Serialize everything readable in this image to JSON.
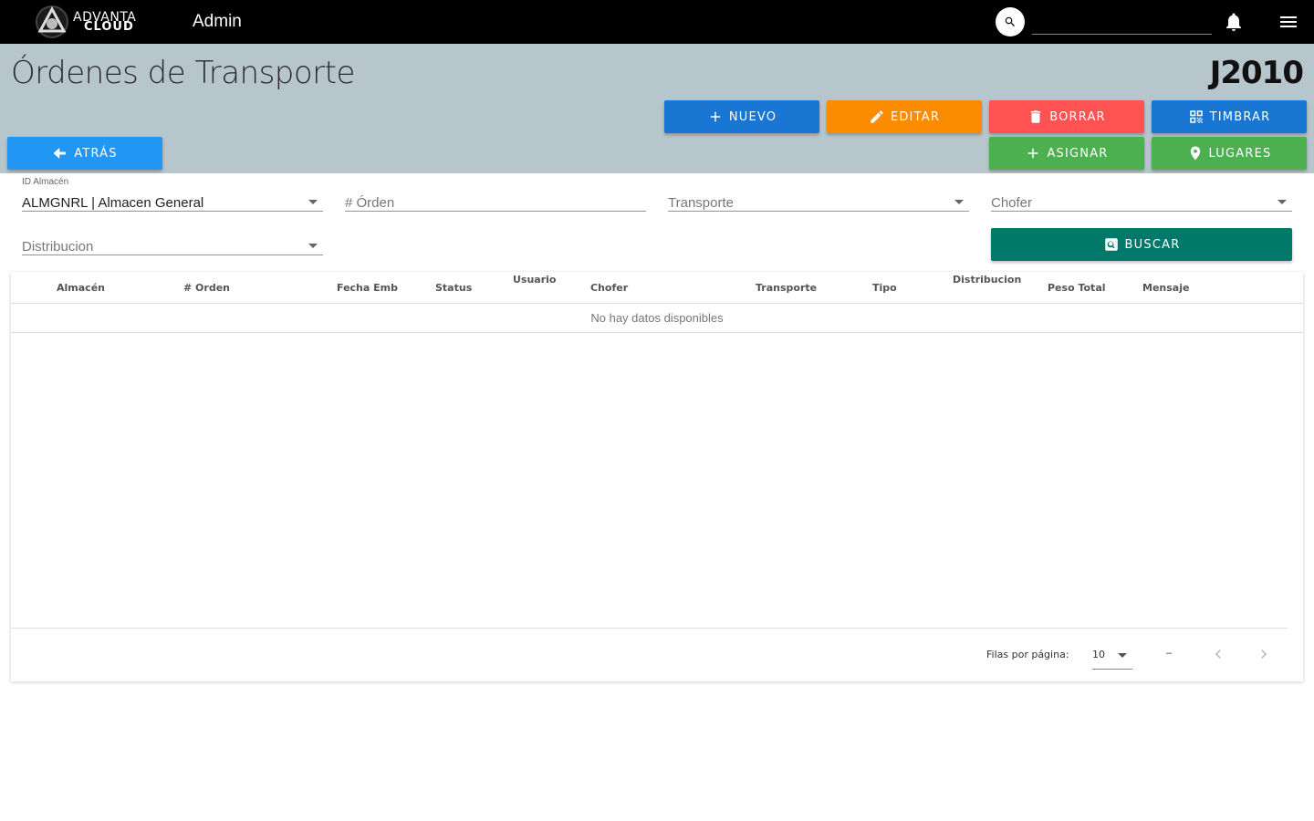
{
  "topbar": {
    "logo_line1": "ADVANTA",
    "logo_line2": "CLOUD",
    "app_title": "Admin",
    "search_value": ""
  },
  "header": {
    "title": "Órdenes de Transporte",
    "code": "J2010"
  },
  "actions": {
    "nuevo": "NUEVO",
    "editar": "EDITAR",
    "borrar": "BORRAR",
    "timbrar": "TIMBRAR",
    "asignar": "ASIGNAR",
    "lugares": "LUGARES",
    "atras": "ATRÁS",
    "buscar": "BUSCAR"
  },
  "filters": {
    "almacen_label": "ID Almacén",
    "almacen_value": "ALMGNRL | Almacen General",
    "orden_placeholder": "# Órden",
    "transporte_placeholder": "Transporte",
    "chofer_placeholder": "Chofer",
    "distribucion_placeholder": "Distribucion"
  },
  "table": {
    "columns": [
      "Almacén",
      "# Orden",
      "Fecha Emb",
      "Status",
      "Usuario",
      "Chofer",
      "Transporte",
      "Tipo",
      "Distribucion",
      "Peso Total",
      "Mensaje"
    ],
    "empty_text": "No hay datos disponibles",
    "rows_per_page_label": "Filas por página:",
    "rows_per_page_value": "10",
    "range_text": "–"
  },
  "colors": {
    "topbar": "#000000",
    "band": "#b7c5cc",
    "blue": "#1976d2",
    "orange": "#fb8c00",
    "red": "#ff5252",
    "green": "#4caf50",
    "teal": "#00796b",
    "light_blue": "#2196f3"
  }
}
